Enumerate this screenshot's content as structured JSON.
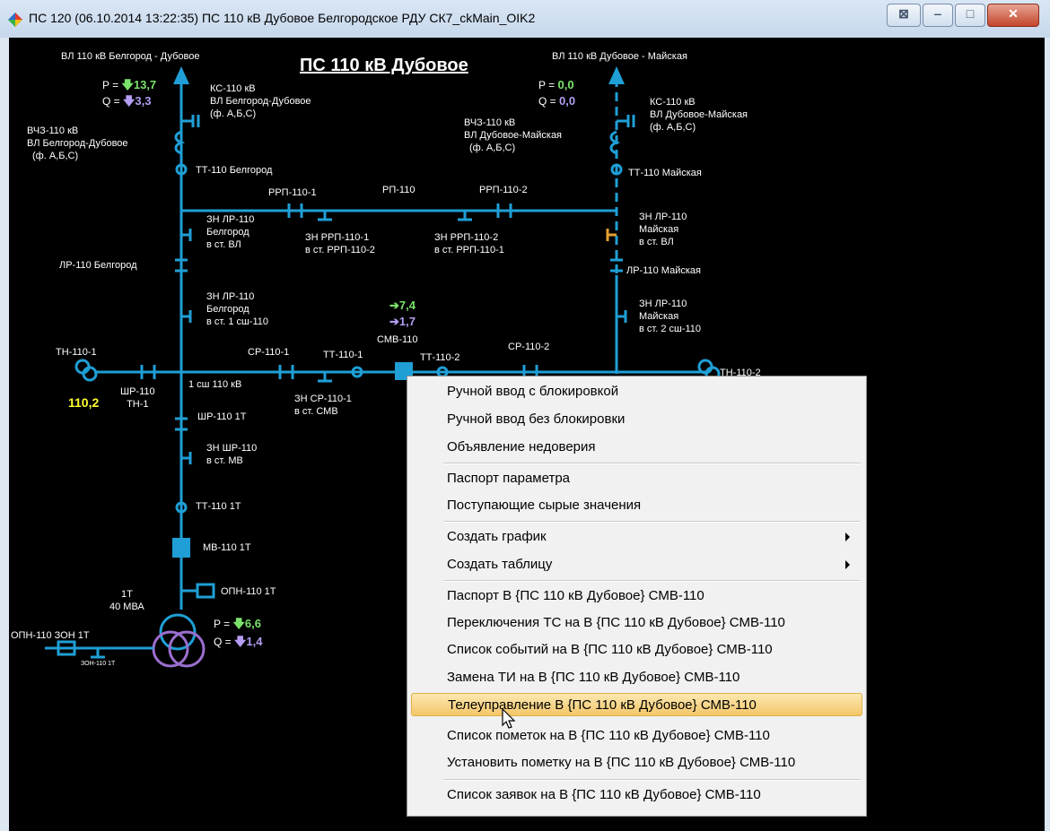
{
  "window": {
    "title": "ПС 120   (06.10.2014 13:22:35) ПС 110 кВ Дубовое  Белгородское РДУ СК7_ckMain_OIK2",
    "buttons": {
      "restore": "⊠",
      "minimize": "‒",
      "maximize": "□",
      "close": "✕"
    }
  },
  "scheme": {
    "title": "ПС 110 кВ Дубовое",
    "line_left": "ВЛ 110 кВ Белгород - Дубовое",
    "line_right": "ВЛ 110 кВ Дубовое - Майская",
    "left_p_label": "P =",
    "left_p_value": "13,7",
    "left_q_label": "Q =",
    "left_q_value": "3,3",
    "right_p_label": "P =",
    "right_p_value": "0,0",
    "right_q_label": "Q =",
    "right_q_value": "0,0",
    "ks_left": [
      "КС-110 кВ",
      "ВЛ Белгород-Дубовое",
      "(ф. А,Б,С)"
    ],
    "vchz_left": [
      "ВЧЗ-110 кВ",
      "ВЛ Белгород-Дубовое",
      "(ф. А,Б,С)"
    ],
    "ks_right": [
      "КС-110 кВ",
      "ВЛ Дубовое-Майская",
      "(ф. А,Б,С)"
    ],
    "vchz_right": [
      "ВЧЗ-110 кВ",
      "ВЛ Дубовое-Майская",
      "(ф. А,Б,С)"
    ],
    "tt_left": "ТТ-110 Белгород",
    "tt_right": "ТТ-110 Майская",
    "rrp1": "РРП-110-1",
    "rp": "РП-110",
    "rrp2": "РРП-110-2",
    "zn_lr_left": [
      "ЗН ЛР-110",
      "Белгород",
      "в ст. ВЛ"
    ],
    "zn_rrp1": [
      "ЗН РРП-110-1",
      "в ст. РРП-110-2"
    ],
    "zn_rrp2": [
      "ЗН РРП-110-2",
      "в ст. РРП-110-1"
    ],
    "zn_lr_right": [
      "ЗН ЛР-110",
      "Майская",
      "в ст. ВЛ"
    ],
    "lr_left": "ЛР-110 Белгород",
    "lr_right": "ЛР-110 Майская",
    "zn_lr_left_bus": [
      "ЗН ЛР-110",
      "Белгород",
      "в ст. 1 сш-110"
    ],
    "zn_lr_right_bus": [
      "ЗН ЛР-110",
      "Майская",
      "в ст. 2 сш-110"
    ],
    "smv_p_value": "7,4",
    "smv_q_value": "1,7",
    "smv": "СМВ-110",
    "tn1": "ТН-110-1",
    "tn2": "ТН-110-2",
    "sr1": "СР-110-1",
    "tt1": "ТТ-110-1",
    "tt2": "ТТ-110-2",
    "sr2": "СР-110-2",
    "voltage": "110,2",
    "shr_tn": [
      "ШР-110",
      "ТН-1"
    ],
    "bus1": "1 сш 110 кВ",
    "zn_sr1": [
      "ЗН СР-110-1",
      "в ст. СМВ"
    ],
    "shr_1t": "ШР-110 1Т",
    "zn_shr": [
      "ЗН ШР-110",
      "в ст. МВ"
    ],
    "tt_1t": "ТТ-110 1Т",
    "mv_1t": "МВ-110 1Т",
    "opn_1t": "ОПН-110 1Т",
    "transformer": [
      "1Т",
      "40 МВА"
    ],
    "tr_p_label": "P =",
    "tr_p_value": "6,6",
    "tr_q_label": "Q =",
    "tr_q_value": "1,4",
    "opn_zon": "ОПН-110 ЗОН 1Т",
    "zon": "ЗОН-110 1Т"
  },
  "context_menu": {
    "items": [
      {
        "label": "Ручной ввод с блокировкой"
      },
      {
        "label": "Ручной ввод без блокировки"
      },
      {
        "label": "Объявление недоверия"
      },
      {
        "label": "Паспорт параметра"
      },
      {
        "label": "Поступающие сырые значения"
      },
      {
        "label": "Создать график",
        "submenu": true
      },
      {
        "label": "Создать таблицу",
        "submenu": true
      },
      {
        "label": "Паспорт В {ПС 110 кВ Дубовое} СМВ-110"
      },
      {
        "label": "Переключения ТС на В {ПС 110 кВ Дубовое} СМВ-110"
      },
      {
        "label": "Список событий на В {ПС 110 кВ Дубовое} СМВ-110"
      },
      {
        "label": "Замена ТИ на В {ПС 110 кВ Дубовое} СМВ-110"
      },
      {
        "label": "Телеуправление В {ПС 110 кВ Дубовое} СМВ-110",
        "highlighted": true
      },
      {
        "label": "Список пометок на В {ПС 110 кВ Дубовое} СМВ-110"
      },
      {
        "label": "Установить пометку на В {ПС 110 кВ Дубовое} СМВ-110"
      },
      {
        "label": "Список заявок на В {ПС 110 кВ Дубовое} СМВ-110"
      }
    ]
  },
  "colors": {
    "line": "#1f9fd6",
    "background": "#000000",
    "p_value": "#7be36b",
    "q_value": "#b49df2",
    "voltage": "#ffff33",
    "earth_switch_active": "#e6a030",
    "menu_highlight": "#f4c66a"
  }
}
